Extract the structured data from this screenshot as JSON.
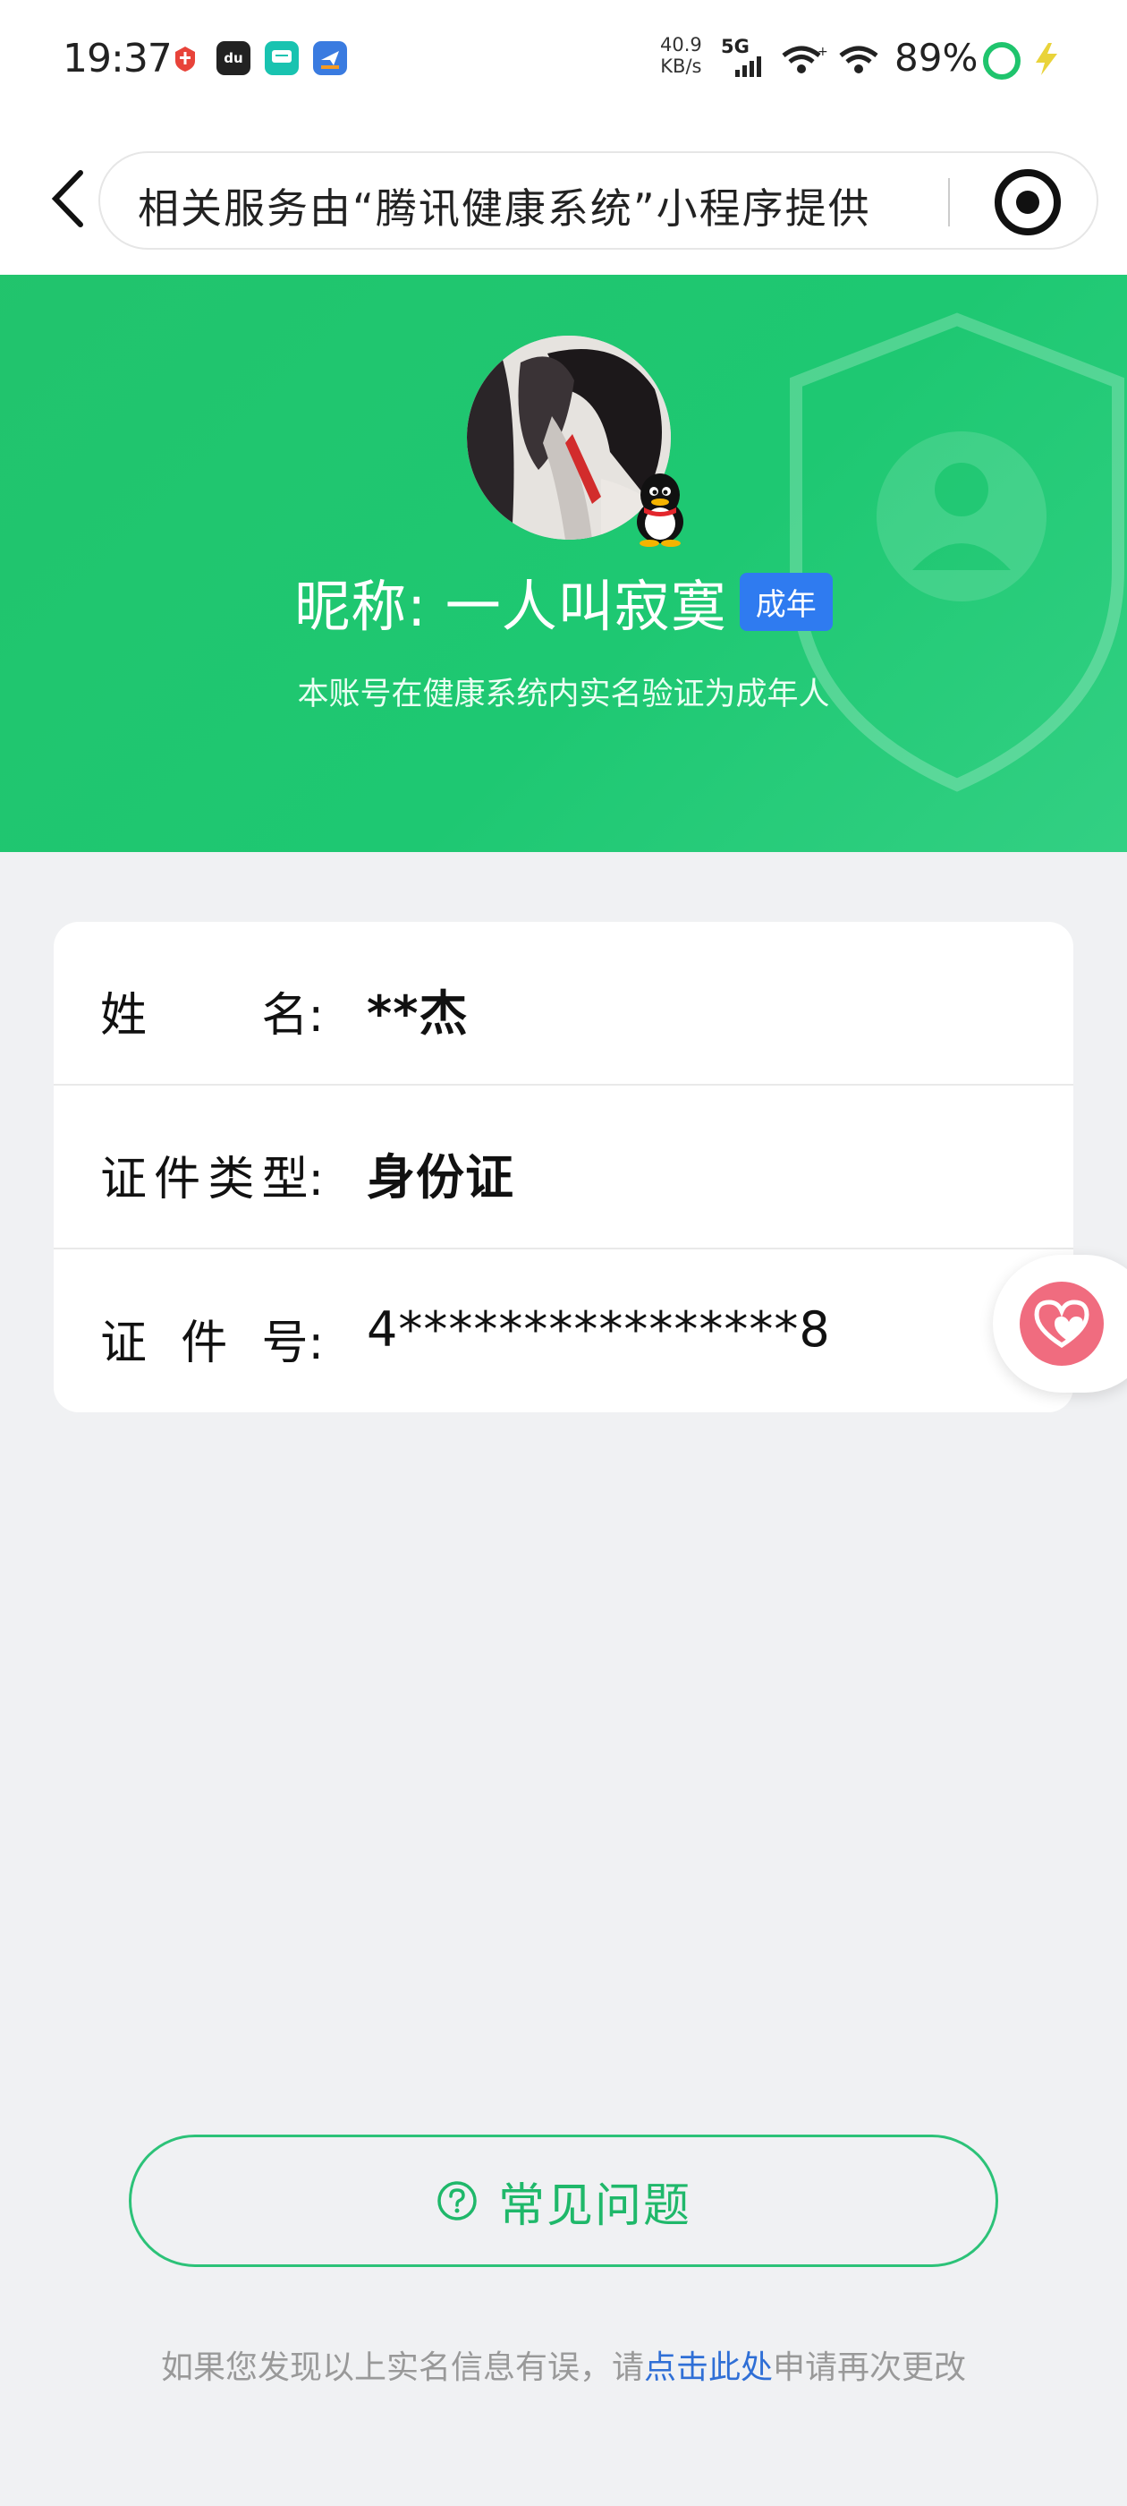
{
  "status_bar": {
    "time": "19:37",
    "apps": [
      {
        "icon": "news-app-icon",
        "color": "#e8433a",
        "text": ""
      },
      {
        "icon": "du-app-icon",
        "color": "#222222",
        "text": "du"
      },
      {
        "icon": "chat-app-icon",
        "color": "#19c3b0",
        "text": ""
      },
      {
        "icon": "plane-app-icon",
        "color": "#3a7be0",
        "text": ""
      }
    ],
    "speed_value": "40.9",
    "speed_unit": "KB/s",
    "network": "5G",
    "battery_percent": "89%"
  },
  "nav": {
    "provider_text": "相关服务由“腾讯健康系统”小程序提供"
  },
  "hero": {
    "nickname": "昵称: 一人叫寂寞",
    "adult_badge": "成年",
    "subtitle": "本账号在健康系统内实名验证为成年人"
  },
  "info": {
    "rows": [
      {
        "label": [
          "姓",
          "名:"
        ],
        "value": "**杰"
      },
      {
        "label": [
          "证",
          "件",
          "类",
          "型:"
        ],
        "value": "身份证"
      },
      {
        "label": [
          "证",
          "件",
          "号:"
        ],
        "value": "4****************8"
      }
    ]
  },
  "faq": {
    "label": "常见问题"
  },
  "footer": {
    "prefix": "如果您发现以上实名信息有误，请",
    "link": "点击此处",
    "suffix": "申请再次更改"
  },
  "colors": {
    "brand_green": "#1fc46d",
    "badge_blue": "#2f7bf0",
    "link_blue": "#2f6fd6",
    "heart_pink": "#f06c7f"
  }
}
